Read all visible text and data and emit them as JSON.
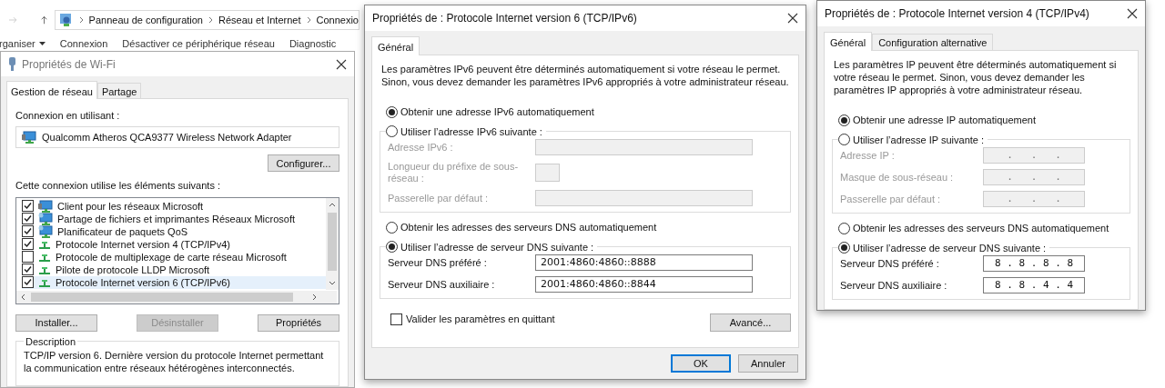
{
  "explorer": {
    "breadcrumbs": [
      "Panneau de configuration",
      "Réseau et Internet",
      "Connexio"
    ],
    "toolbar": [
      {
        "label": "rganiser",
        "kind": "menu"
      },
      {
        "label": "Connexion",
        "kind": "plain"
      },
      {
        "label": "Désactiver ce périphérique réseau",
        "kind": "plain"
      },
      {
        "label": "Diagnostic",
        "kind": "plain"
      }
    ]
  },
  "wifi_dialog": {
    "title": "Propriétés de Wi-Fi",
    "tabs": [
      {
        "label": "Gestion de réseau",
        "selected": true
      },
      {
        "label": "Partage",
        "selected": false
      }
    ],
    "connect_using_label": "Connexion en utilisant :",
    "adapter": "Qualcomm Atheros QCA9377 Wireless Network Adapter",
    "configure_button": "Configurer...",
    "items_label": "Cette connexion utilise les éléments suivants :",
    "items": [
      {
        "label": "Client pour les réseaux Microsoft",
        "kind": "client",
        "checked": true,
        "selected": false
      },
      {
        "label": "Partage de fichiers et imprimantes Réseaux Microsoft",
        "kind": "service",
        "checked": true,
        "selected": false
      },
      {
        "label": "Planificateur de paquets QoS",
        "kind": "service",
        "checked": true,
        "selected": false
      },
      {
        "label": "Protocole Internet version 4 (TCP/IPv4)",
        "kind": "protocol",
        "checked": true,
        "selected": false
      },
      {
        "label": "Protocole de multiplexage de carte réseau Microsoft",
        "kind": "protocol",
        "checked": false,
        "selected": false
      },
      {
        "label": "Pilote de protocole LLDP Microsoft",
        "kind": "protocol",
        "checked": true,
        "selected": false
      },
      {
        "label": "Protocole Internet version 6 (TCP/IPv6)",
        "kind": "protocol",
        "checked": true,
        "selected": true
      }
    ],
    "buttons": [
      {
        "label": "Installer...",
        "disabled": false
      },
      {
        "label": "Désinstaller",
        "disabled": true
      },
      {
        "label": "Propriétés",
        "disabled": false
      }
    ],
    "description": {
      "legend": "Description",
      "text": "TCP/IP version 6. Dernière version du protocole Internet permettant la communication entre réseaux hétérogènes interconnectés."
    }
  },
  "ipv6_dialog": {
    "title": "Propriétés de : Protocole Internet version 6 (TCP/IPv6)",
    "tabs": [
      {
        "label": "Général",
        "selected": true
      }
    ],
    "intro": "Les paramètres IPv6 peuvent être déterminés automatiquement si votre réseau le permet. Sinon, vous devez demander les paramètres IPv6 appropriés à votre administrateur réseau.",
    "address": {
      "options": [
        {
          "label": "Obtenir une adresse IPv6 automatiquement",
          "selected": true
        },
        {
          "label": "Utiliser l’adresse IPv6 suivante :",
          "selected": false
        }
      ],
      "fields": [
        {
          "label": "Adresse IPv6 :",
          "kind": "wide"
        },
        {
          "label": "Longueur du préfixe de sous-réseau :",
          "kind": "short"
        },
        {
          "label": "Passerelle par défaut :",
          "kind": "wide"
        }
      ]
    },
    "dns": {
      "options": [
        {
          "label": "Obtenir les adresses des serveurs DNS automatiquement",
          "selected": false
        },
        {
          "label": "Utiliser l’adresse de serveur DNS suivante :",
          "selected": true
        }
      ],
      "fields": [
        {
          "label": "Serveur DNS préféré :",
          "kind": "wide",
          "value": "2001:4860:4860::8888"
        },
        {
          "label": "Serveur DNS auxiliaire :",
          "kind": "wide",
          "value": "2001:4860:4860::8844"
        }
      ]
    },
    "validate": {
      "label": "Valider les paramètres en quittant",
      "checked": false
    },
    "advanced_button": "Avancé...",
    "ok_button": "OK",
    "cancel_button": "Annuler"
  },
  "ipv4_dialog": {
    "title": "Propriétés de : Protocole Internet version 4 (TCP/IPv4)",
    "tabs": [
      {
        "label": "Général",
        "selected": true
      },
      {
        "label": "Configuration alternative",
        "selected": false
      }
    ],
    "intro": "Les paramètres IP peuvent être déterminés automatiquement si votre réseau le permet. Sinon, vous devez demander les paramètres IP appropriés à votre administrateur réseau.",
    "address": {
      "options": [
        {
          "label": "Obtenir une adresse IP automatiquement",
          "selected": true
        },
        {
          "label": "Utiliser l’adresse IP suivante :",
          "selected": false
        }
      ],
      "fields": [
        {
          "label": "Adresse IP :",
          "kind": "ip",
          "value": ".   .   ."
        },
        {
          "label": "Masque de sous-réseau :",
          "kind": "ip",
          "value": ".   .   ."
        },
        {
          "label": "Passerelle par défaut :",
          "kind": "ip",
          "value": ".   .   ."
        }
      ]
    },
    "dns": {
      "options": [
        {
          "label": "Obtenir les adresses des serveurs DNS automatiquement",
          "selected": false
        },
        {
          "label": "Utiliser l’adresse de serveur DNS suivante :",
          "selected": true
        }
      ],
      "fields": [
        {
          "label": "Serveur DNS préféré :",
          "kind": "ip",
          "value": "8 . 8 . 8 . 8"
        },
        {
          "label": "Serveur DNS auxiliaire :",
          "kind": "ip",
          "value": "8 . 8 . 4 . 4"
        }
      ]
    }
  }
}
